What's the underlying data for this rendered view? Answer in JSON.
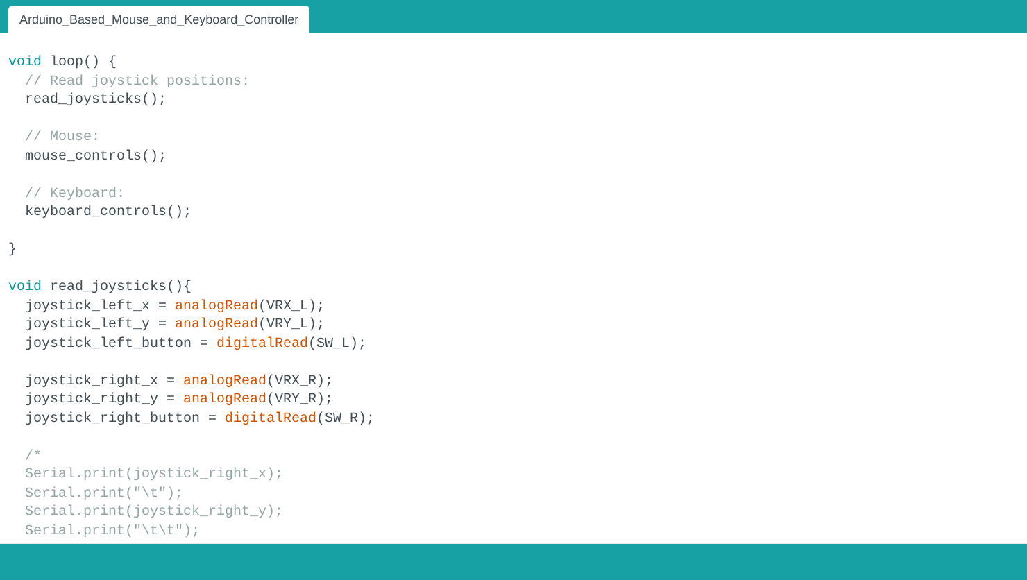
{
  "tabs": [
    {
      "label": "Arduino_Based_Mouse_and_Keyboard_Controller",
      "selected": true
    }
  ],
  "code": [
    {
      "kind": "code",
      "segments": [
        {
          "kind": "keyword",
          "text": "void"
        },
        {
          "kind": "plain",
          "text": " loop() {"
        }
      ]
    },
    {
      "kind": "code",
      "segments": [
        {
          "kind": "comment",
          "text": "  // Read joystick positions:"
        }
      ]
    },
    {
      "kind": "code",
      "segments": [
        {
          "kind": "plain",
          "text": "  read_joysticks();"
        }
      ]
    },
    {
      "kind": "blank"
    },
    {
      "kind": "code",
      "segments": [
        {
          "kind": "comment",
          "text": "  // Mouse:"
        }
      ]
    },
    {
      "kind": "code",
      "segments": [
        {
          "kind": "plain",
          "text": "  mouse_controls();"
        }
      ]
    },
    {
      "kind": "blank"
    },
    {
      "kind": "code",
      "segments": [
        {
          "kind": "comment",
          "text": "  // Keyboard:"
        }
      ]
    },
    {
      "kind": "code",
      "segments": [
        {
          "kind": "plain",
          "text": "  keyboard_controls();"
        }
      ]
    },
    {
      "kind": "blank"
    },
    {
      "kind": "code",
      "segments": [
        {
          "kind": "plain",
          "text": "}"
        }
      ]
    },
    {
      "kind": "blank"
    },
    {
      "kind": "code",
      "segments": [
        {
          "kind": "keyword",
          "text": "void"
        },
        {
          "kind": "plain",
          "text": " read_joysticks(){"
        }
      ]
    },
    {
      "kind": "code",
      "segments": [
        {
          "kind": "plain",
          "text": "  joystick_left_x = "
        },
        {
          "kind": "function",
          "text": "analogRead"
        },
        {
          "kind": "plain",
          "text": "(VRX_L);"
        }
      ]
    },
    {
      "kind": "code",
      "segments": [
        {
          "kind": "plain",
          "text": "  joystick_left_y = "
        },
        {
          "kind": "function",
          "text": "analogRead"
        },
        {
          "kind": "plain",
          "text": "(VRY_L);"
        }
      ]
    },
    {
      "kind": "code",
      "segments": [
        {
          "kind": "plain",
          "text": "  joystick_left_button = "
        },
        {
          "kind": "function",
          "text": "digitalRead"
        },
        {
          "kind": "plain",
          "text": "(SW_L);"
        }
      ]
    },
    {
      "kind": "blank"
    },
    {
      "kind": "code",
      "segments": [
        {
          "kind": "plain",
          "text": "  joystick_right_x = "
        },
        {
          "kind": "function",
          "text": "analogRead"
        },
        {
          "kind": "plain",
          "text": "(VRX_R);"
        }
      ]
    },
    {
      "kind": "code",
      "segments": [
        {
          "kind": "plain",
          "text": "  joystick_right_y = "
        },
        {
          "kind": "function",
          "text": "analogRead"
        },
        {
          "kind": "plain",
          "text": "(VRY_R);"
        }
      ]
    },
    {
      "kind": "code",
      "segments": [
        {
          "kind": "plain",
          "text": "  joystick_right_button = "
        },
        {
          "kind": "function",
          "text": "digitalRead"
        },
        {
          "kind": "plain",
          "text": "(SW_R);"
        }
      ]
    },
    {
      "kind": "blank"
    },
    {
      "kind": "code",
      "segments": [
        {
          "kind": "comment",
          "text": "  /*"
        }
      ]
    },
    {
      "kind": "code",
      "segments": [
        {
          "kind": "comment",
          "text": "  Serial.print(joystick_right_x);"
        }
      ]
    },
    {
      "kind": "code",
      "segments": [
        {
          "kind": "comment",
          "text": "  Serial.print(\"\\t\");"
        }
      ]
    },
    {
      "kind": "code",
      "segments": [
        {
          "kind": "comment",
          "text": "  Serial.print(joystick_right_y);"
        }
      ]
    },
    {
      "kind": "code",
      "segments": [
        {
          "kind": "comment",
          "text": "  Serial.print(\"\\t\\t\");"
        }
      ]
    }
  ]
}
